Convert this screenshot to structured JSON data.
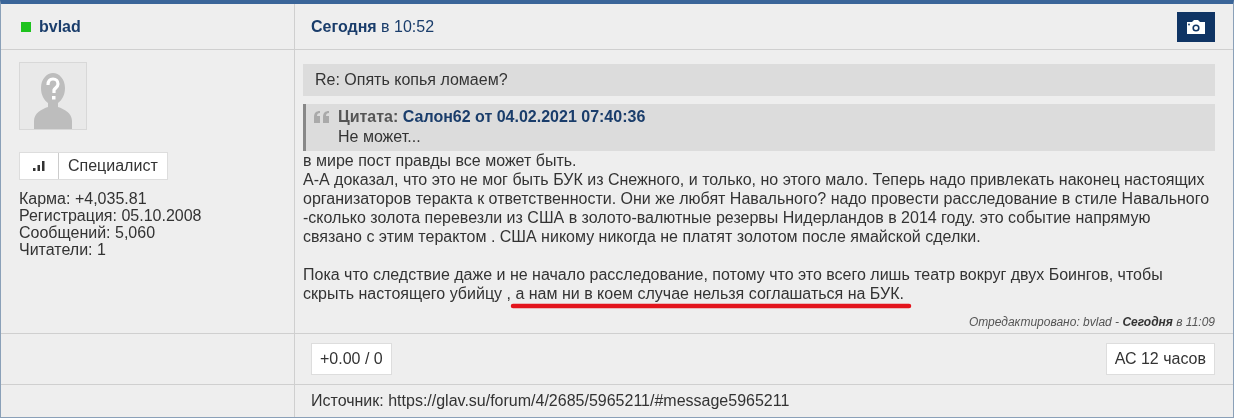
{
  "author": {
    "name": "bvlad",
    "online": true,
    "rank": "Специалист",
    "stats": [
      "Карма: +4,035.81",
      "Регистрация: 05.10.2008",
      "Сообщений: 5,060",
      "Читатели: 1"
    ]
  },
  "post": {
    "date_bold": "Сегодня",
    "date_rest": "в 10:52",
    "subject": "Re: Опять копья ломаем?",
    "quote": {
      "label": "Цитата:",
      "source": "Салон62 от 04.02.2021 07:40:36",
      "text": "Не может..."
    },
    "paragraphs": [
      [
        "в мире пост правды все может быть.",
        "А-А доказал, что это не мог быть БУК из Снежного, и только, но этого мало. Теперь надо привлекать наконец настоящих",
        "организаторов теракта к ответственности. Они же любят Навального? надо провести расследование в стиле Навального",
        "-сколько золота перевезли из США в золото-валютные резервы Нидерландов в 2014 году. это событие напрямую",
        "связано с этим терактом . США никому никогда не платят золотом после ямайской сделки."
      ],
      [
        "Пока что следствие даже и не начало расследование, потому что это всего лишь театр вокруг двух Боингов, чтобы",
        "скрыть настоящего убийцу , а нам ни в коем случае нельзя соглашаться на БУК."
      ]
    ],
    "edited": "Отредактировано: bvlad - **Сегодня** в 11:09",
    "rating": "+0.00 / 0",
    "age": "АС 12 часов",
    "source": "Источник: https://glav.su/forum/4/2685/5965211/#message5965211"
  }
}
